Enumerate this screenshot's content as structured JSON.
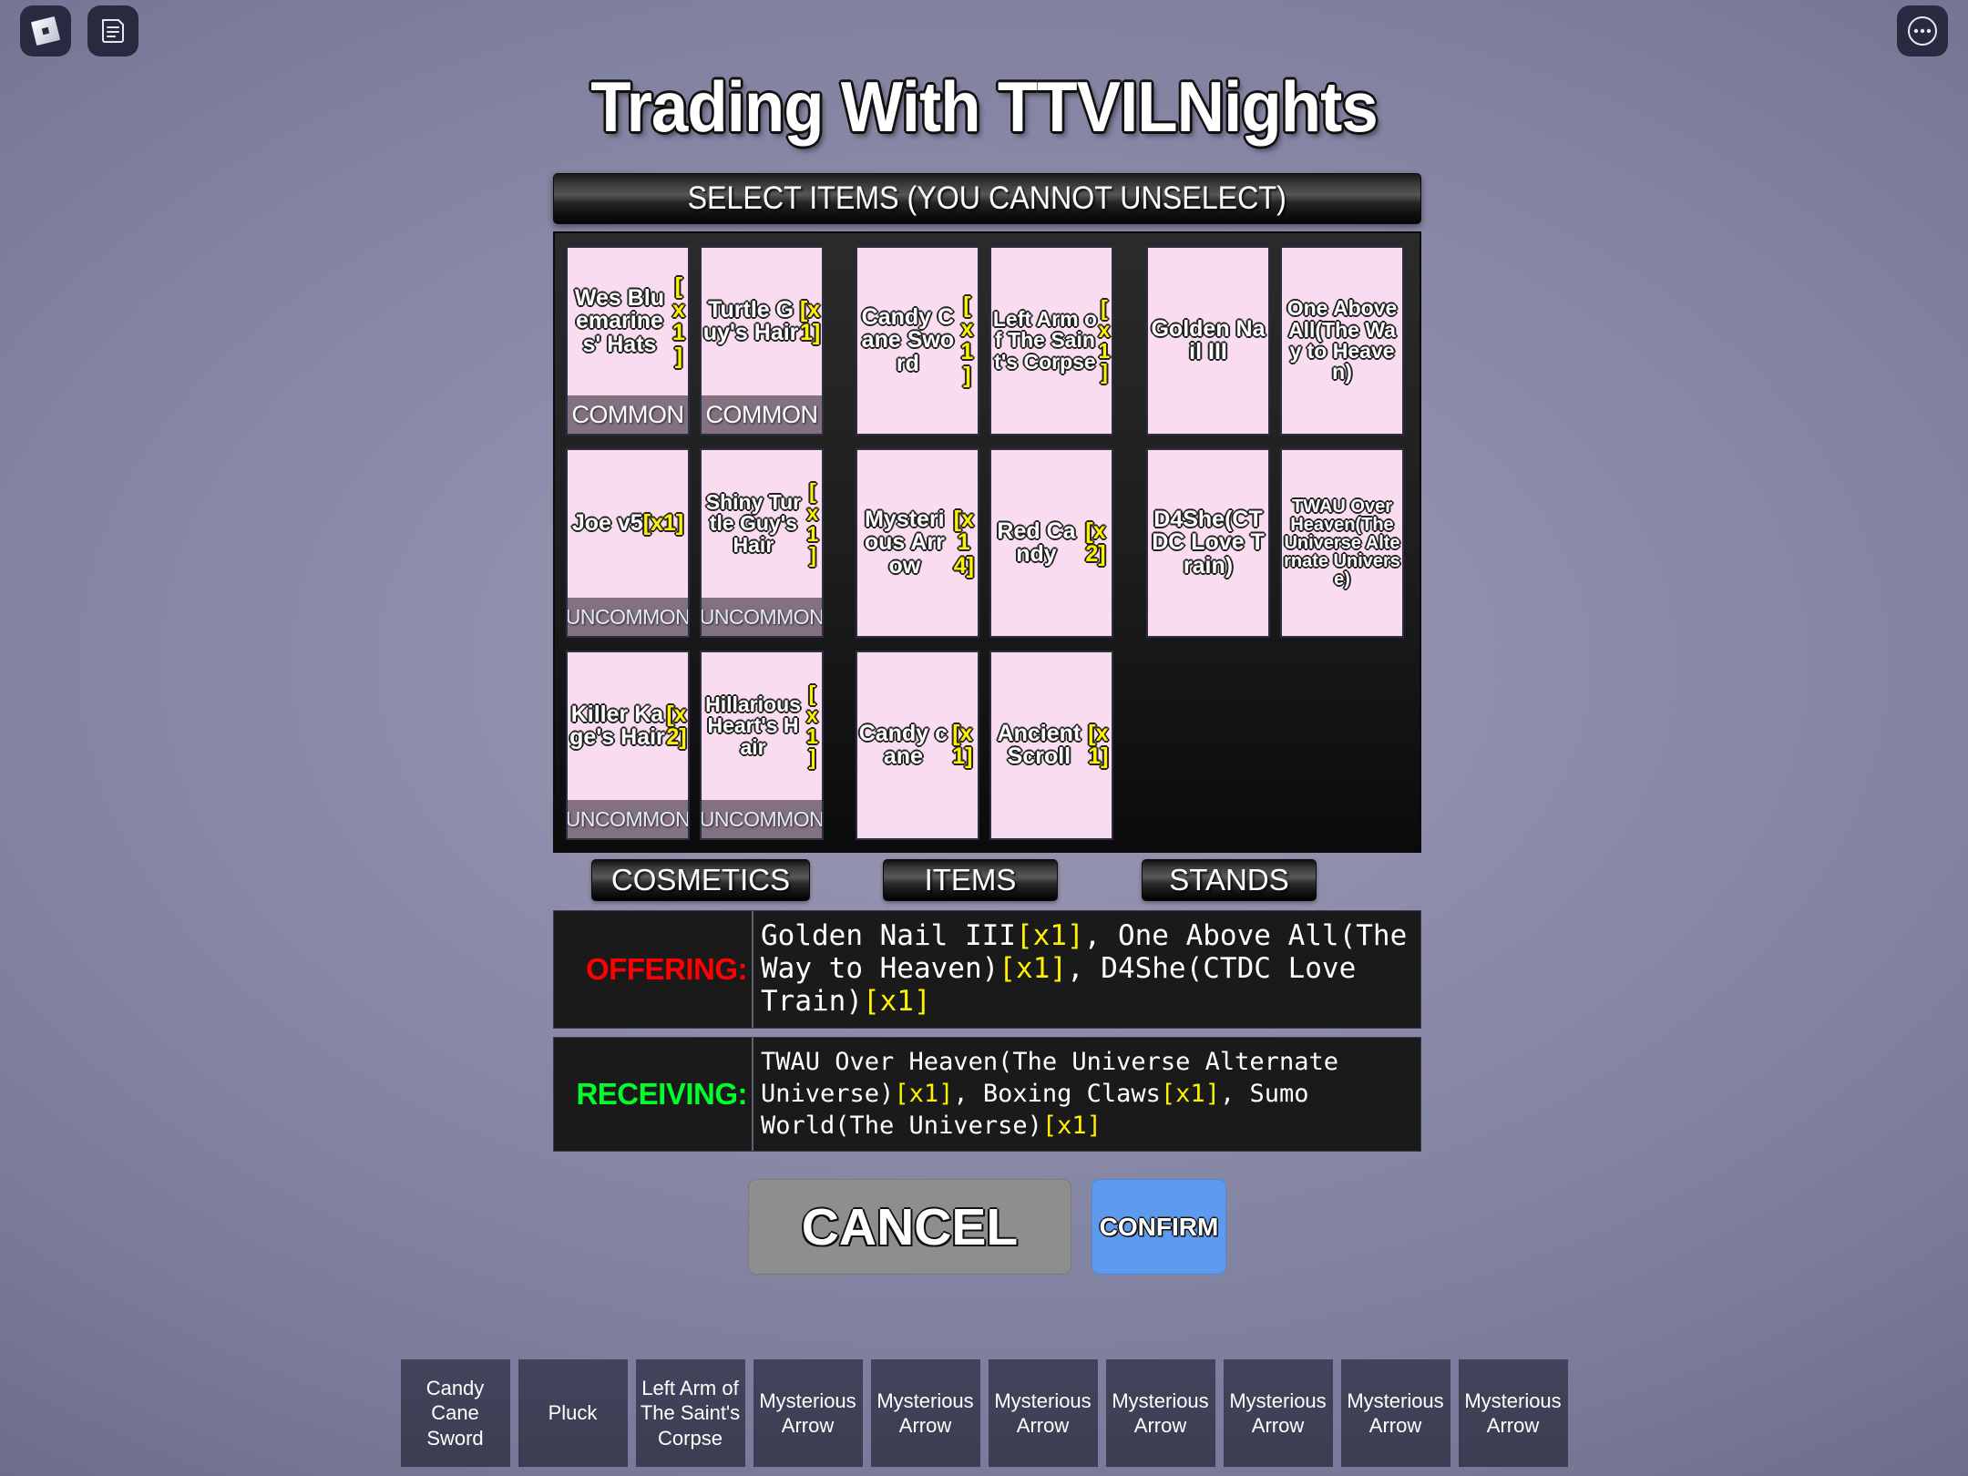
{
  "topbar": {
    "left_icons": [
      {
        "name": "roblox-logo-icon",
        "label": "Roblox"
      },
      {
        "name": "chat-icon",
        "label": "Chat"
      }
    ],
    "right_icon": {
      "name": "more-options-icon",
      "label": "More"
    }
  },
  "title": "Trading With TTVILNights",
  "header": {
    "text": "SELECT ITEMS (YOU CANNOT UNSELECT)"
  },
  "inventory": {
    "rows": [
      [
        {
          "name": "Wes Bluemarines' Hats",
          "qty": "[x1]",
          "rarity": "COMMON",
          "size": "normal"
        },
        {
          "name": "Turtle Guy's Hair",
          "qty": "[x1]",
          "rarity": "COMMON",
          "size": "normal"
        },
        {
          "name": "Candy Cane Sword",
          "qty": "[x1]",
          "rarity": "",
          "size": "normal"
        },
        {
          "name": "Left Arm of The Saint's Corpse",
          "qty": "[x1]",
          "rarity": "",
          "size": "small"
        },
        {
          "name": "Golden Nail III",
          "qty": "",
          "rarity": "",
          "size": "normal"
        },
        {
          "name": "One Above All(The Way to Heaven)",
          "qty": "",
          "rarity": "",
          "size": "small"
        }
      ],
      [
        {
          "name": "Joe v5",
          "qty": "[x1]",
          "rarity": "UNCOMMON",
          "size": "normal"
        },
        {
          "name": "Shiny Turtle Guy's Hair",
          "qty": "[x1]",
          "rarity": "UNCOMMON",
          "size": "small"
        },
        {
          "name": "Mysterious Arrow",
          "qty": "[x14]",
          "rarity": "",
          "size": "normal"
        },
        {
          "name": "Red Candy",
          "qty": "[x2]",
          "rarity": "",
          "size": "normal"
        },
        {
          "name": "D4She(CTDC Love Train)",
          "qty": "",
          "rarity": "",
          "size": "normal"
        },
        {
          "name": "TWAU Over Heaven(The Universe Alternate Universe)",
          "qty": "",
          "rarity": "",
          "size": "tiny"
        }
      ],
      [
        {
          "name": "Killer Kage's Hair",
          "qty": "[x2]",
          "rarity": "UNCOMMON",
          "size": "normal"
        },
        {
          "name": "Hillarious Heart's Hair",
          "qty": "[x1]",
          "rarity": "UNCOMMON",
          "size": "small"
        },
        {
          "name": "Candy cane",
          "qty": "[x1]",
          "rarity": "",
          "size": "normal"
        },
        {
          "name": "Ancient Scroll",
          "qty": "[x1]",
          "rarity": "",
          "size": "normal"
        }
      ]
    ]
  },
  "categories": [
    {
      "label": "COSMETICS"
    },
    {
      "label": "ITEMS"
    },
    {
      "label": "STANDS"
    }
  ],
  "trade": {
    "offering_label": "OFFERING:",
    "offering_parts": [
      {
        "t": "Golden Nail III",
        "q": false
      },
      {
        "t": "[x1]",
        "q": true
      },
      {
        "t": ", One Above All(The Way to Heaven)",
        "q": false
      },
      {
        "t": "[x1]",
        "q": true
      },
      {
        "t": ", D4She(CTDC Love Train)",
        "q": false
      },
      {
        "t": "[x1]",
        "q": true
      }
    ],
    "receiving_label": "RECEIVING:",
    "receiving_parts": [
      {
        "t": "TWAU Over Heaven(The Universe Alternate Universe)",
        "q": false
      },
      {
        "t": "[x1]",
        "q": true
      },
      {
        "t": ", Boxing Claws",
        "q": false
      },
      {
        "t": "[x1]",
        "q": true
      },
      {
        "t": ", Sumo World(The Universe)",
        "q": false
      },
      {
        "t": "[x1]",
        "q": true
      }
    ]
  },
  "actions": {
    "cancel_label": "CANCEL",
    "confirm_label": "CONFIRM"
  },
  "hotbar": {
    "slots": [
      {
        "label": "Candy Cane Sword"
      },
      {
        "label": "Pluck"
      },
      {
        "label": "Left Arm of The Saint's Corpse"
      },
      {
        "label": "Mysterious Arrow"
      },
      {
        "label": "Mysterious Arrow"
      },
      {
        "label": "Mysterious Arrow"
      },
      {
        "label": "Mysterious Arrow"
      },
      {
        "label": "Mysterious Arrow"
      },
      {
        "label": "Mysterious Arrow"
      },
      {
        "label": "Mysterious Arrow"
      }
    ]
  },
  "colors": {
    "card_bg": "#fadcf0",
    "qty_yellow": "#fff200",
    "offering_red": "#ff0000",
    "receiving_green": "#00ff2a",
    "confirm_blue": "#5d9aee"
  }
}
